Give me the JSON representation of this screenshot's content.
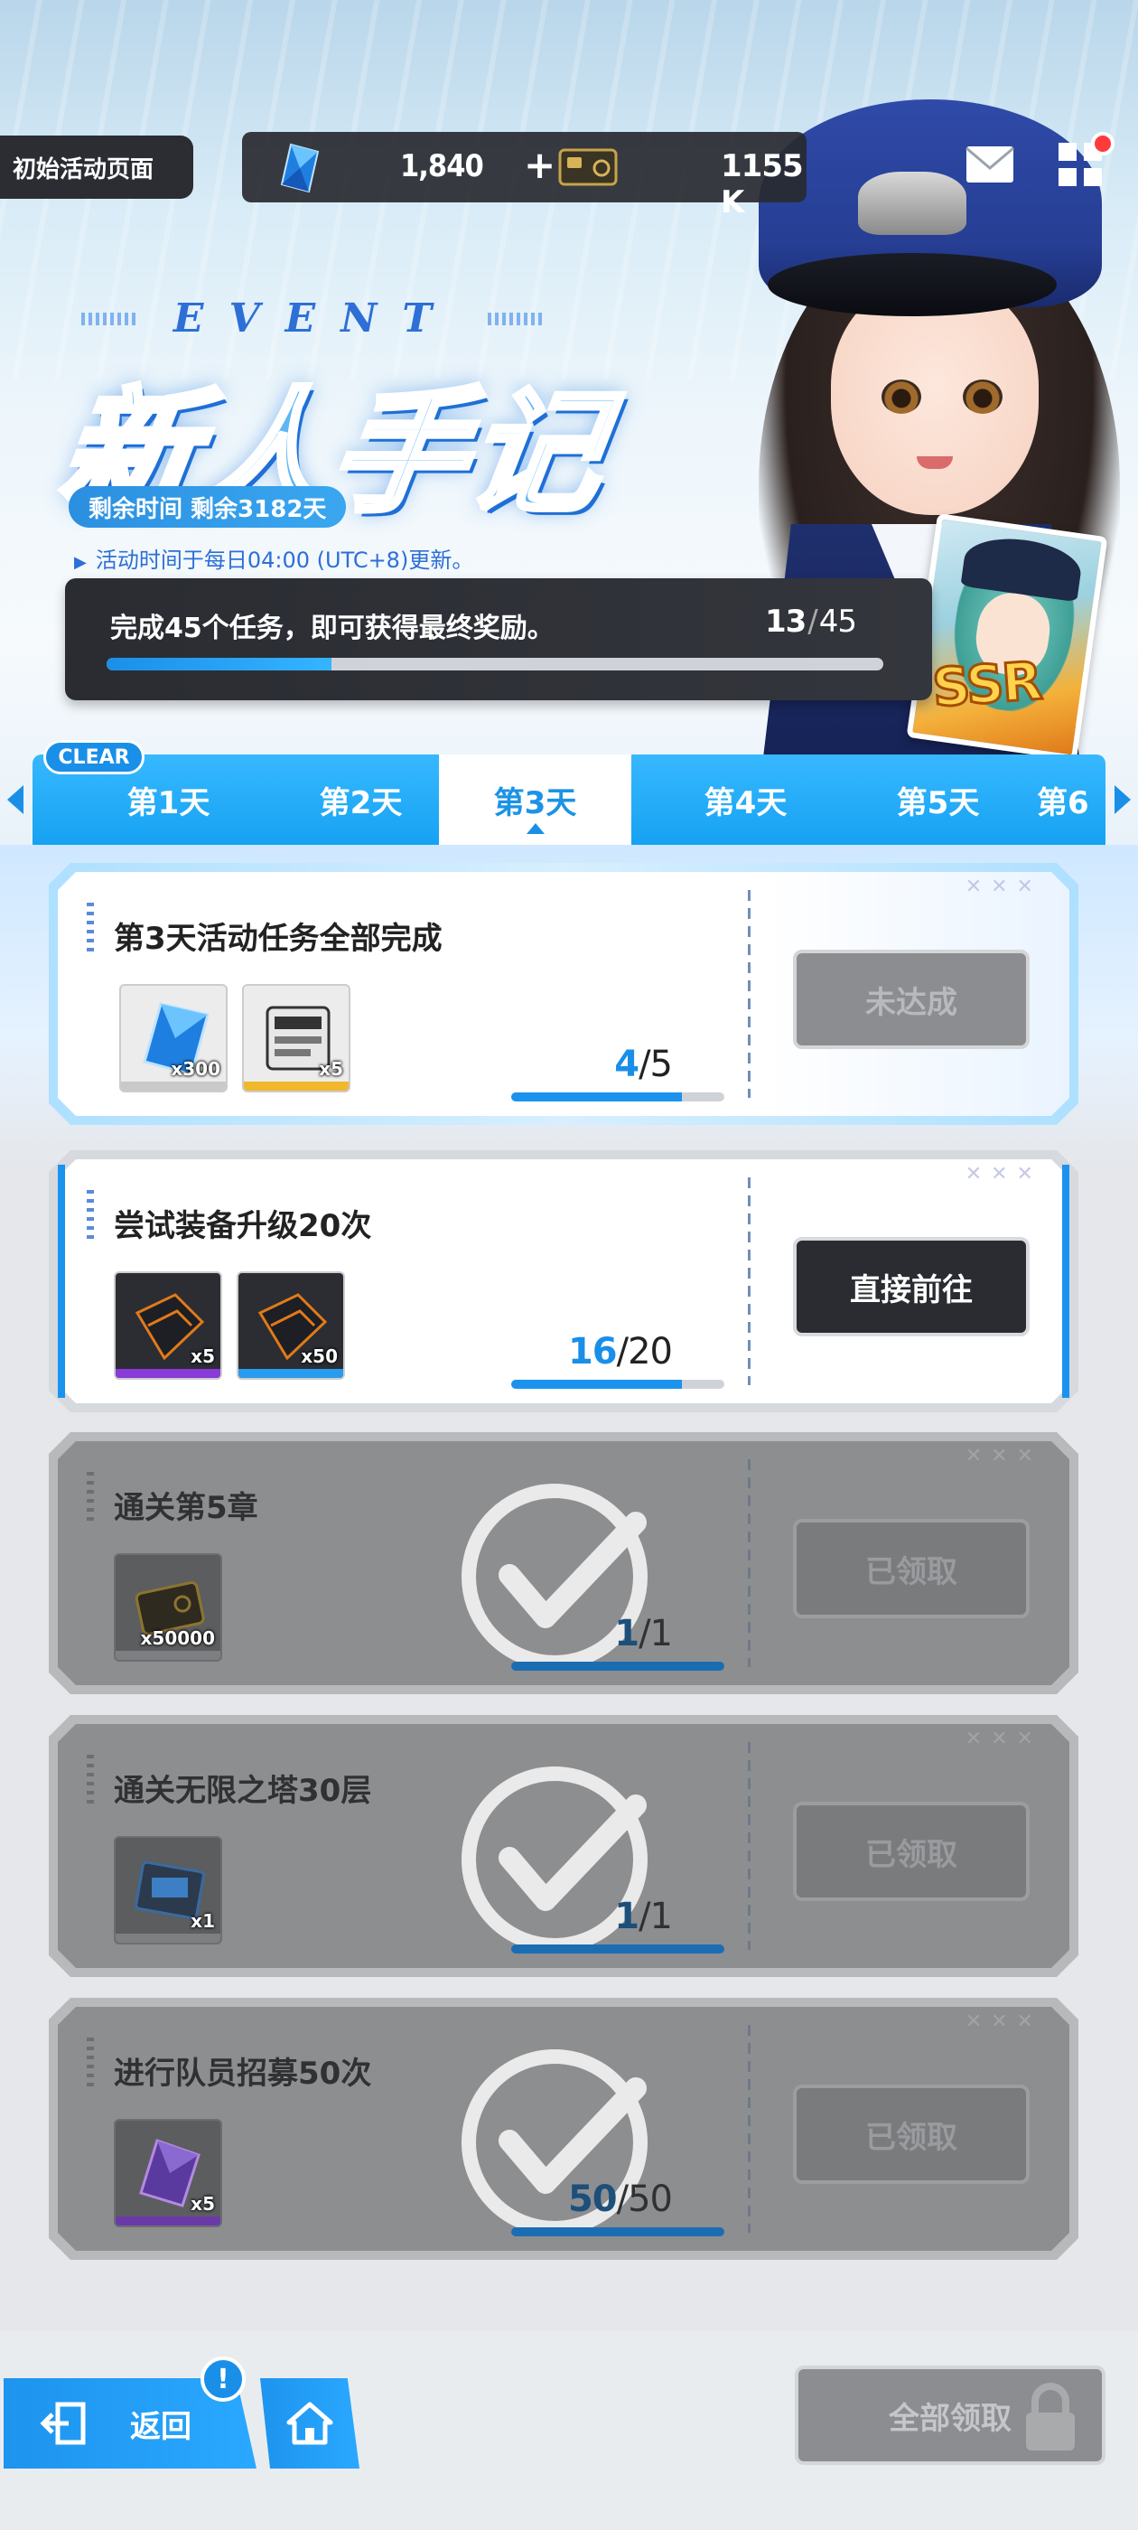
{
  "top_bar": {
    "page_chip": "初始活动页面",
    "gem_count": "1,840",
    "gem_plus": "+",
    "gold_count": "1155 K"
  },
  "event": {
    "subtitle_letters": [
      "E",
      "V",
      "E",
      "N",
      "T"
    ],
    "title": "新人手记",
    "time_remaining": "剩余时间  剩余3182天",
    "refresh_note": "活动时间于每日04:00 (UTC+8)更新。",
    "ssr_label": "SSR"
  },
  "progress": {
    "label": "完成45个任务，即可获得最终奖励。",
    "current": "13",
    "total": "45",
    "fraction": 0.289
  },
  "tabs": {
    "clear_badge": "CLEAR",
    "items": [
      "第1天",
      "第2天",
      "第3天",
      "第4天",
      "第5天",
      "第6"
    ],
    "active_index": 2
  },
  "missions": [
    {
      "title": "第3天活动任务全部完成",
      "rewards": [
        {
          "icon": "gem-icon",
          "qty": "x300"
        },
        {
          "icon": "book-icon",
          "qty": "x5"
        }
      ],
      "current": "4",
      "total": "5",
      "fraction": 0.8,
      "action": "未达成",
      "state": "highlight"
    },
    {
      "title": "尝试装备升级20次",
      "rewards": [
        {
          "icon": "equipment-box-icon",
          "qty": "x5"
        },
        {
          "icon": "equipment-box-icon",
          "qty": "x50"
        }
      ],
      "current": "16",
      "total": "20",
      "fraction": 0.8,
      "action": "直接前往",
      "state": "normal"
    },
    {
      "title": "通关第5章",
      "rewards": [
        {
          "icon": "credit-card-icon",
          "qty": "x50000"
        }
      ],
      "current": "1",
      "total": "1",
      "fraction": 1.0,
      "action": "已领取",
      "state": "done"
    },
    {
      "title": "通关无限之塔30层",
      "rewards": [
        {
          "icon": "ticket-icon",
          "qty": "x1"
        }
      ],
      "current": "1",
      "total": "1",
      "fraction": 1.0,
      "action": "已领取",
      "state": "done"
    },
    {
      "title": "进行队员招募50次",
      "rewards": [
        {
          "icon": "recruit-crystal-icon",
          "qty": "x5"
        }
      ],
      "current": "50",
      "total": "50",
      "fraction": 1.0,
      "action": "已领取",
      "state": "done"
    }
  ],
  "bottom": {
    "back_label": "返回",
    "alert": "!",
    "claim_all_label": "全部领取"
  },
  "colors": {
    "accent_blue": "#1a8fe8",
    "panel_dark": "#2a2c32",
    "claimed_gray": "#8d8e90"
  }
}
